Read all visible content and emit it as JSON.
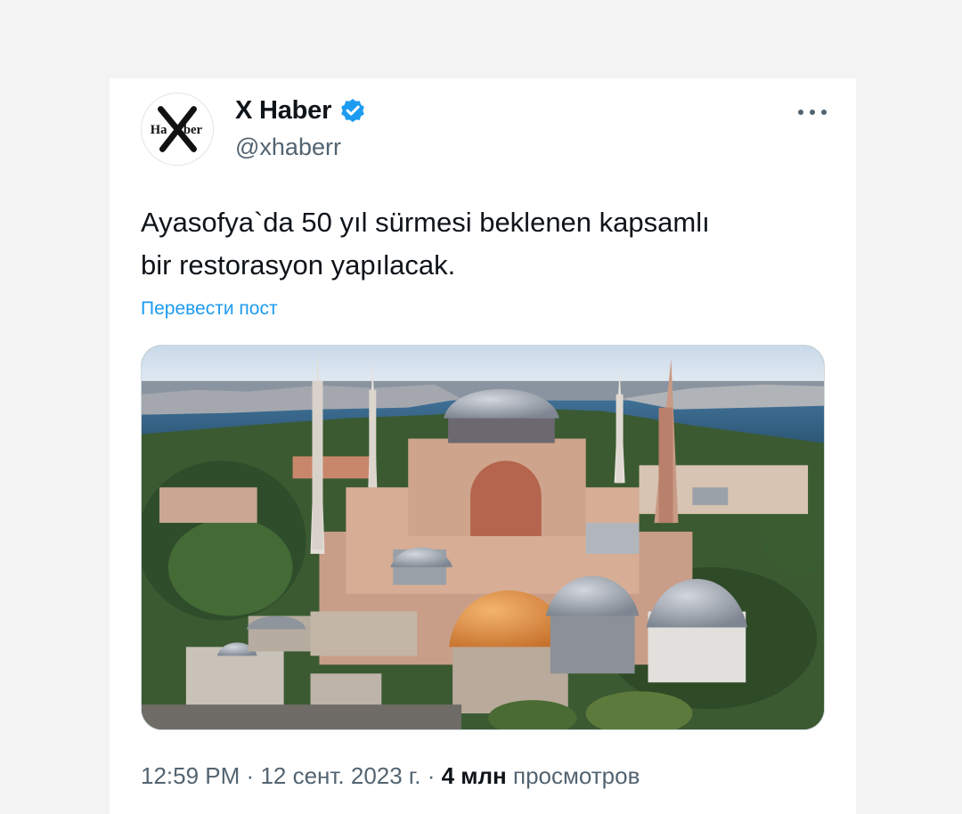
{
  "post": {
    "author": {
      "display_name": "X Haber",
      "handle": "@xhaberr",
      "verified": true,
      "avatar_text": "HaXber"
    },
    "text_lines": [
      "Ayasofya`da 50 yıl sürmesi beklenen kapsamlı",
      "bir restorasyon yapılacak."
    ],
    "translate_label": "Перевести пост",
    "media": {
      "icon": "photo-hagia-sophia"
    },
    "meta": {
      "time": "12:59 PM",
      "separator": "·",
      "date": "12 сент. 2023 г.",
      "views_count": "4 млн",
      "views_label": "просмотров"
    }
  },
  "colors": {
    "text": "#0f1419",
    "secondary": "#536471",
    "link": "#1d9bf0",
    "verified": "#1d9bf0"
  }
}
